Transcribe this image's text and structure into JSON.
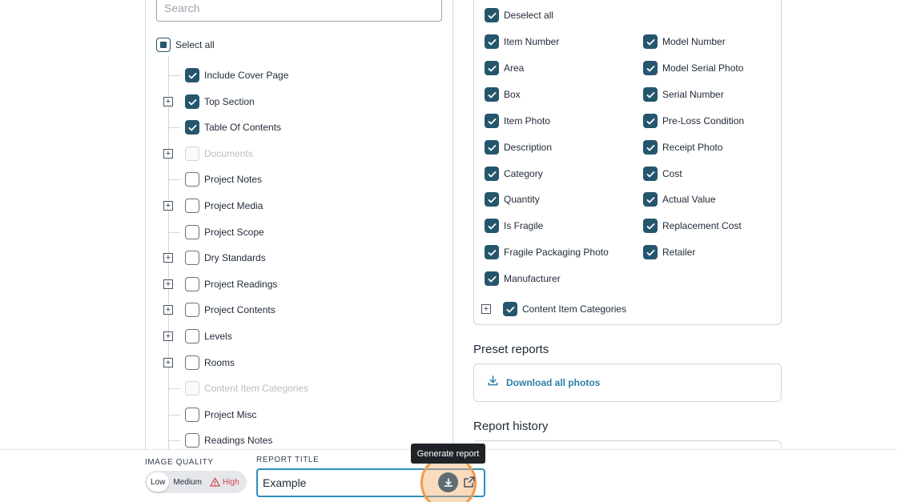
{
  "search": {
    "placeholder": "Search"
  },
  "tree": {
    "select_all_label": "Select all",
    "items": [
      {
        "label": "Include Cover Page",
        "checked": true,
        "disabled": false,
        "expandable": false
      },
      {
        "label": "Top Section",
        "checked": true,
        "disabled": false,
        "expandable": true
      },
      {
        "label": "Table Of Contents",
        "checked": true,
        "disabled": false,
        "expandable": false
      },
      {
        "label": "Documents",
        "checked": false,
        "disabled": true,
        "expandable": true
      },
      {
        "label": "Project Notes",
        "checked": false,
        "disabled": false,
        "expandable": false
      },
      {
        "label": "Project Media",
        "checked": false,
        "disabled": false,
        "expandable": true
      },
      {
        "label": "Project Scope",
        "checked": false,
        "disabled": false,
        "expandable": false
      },
      {
        "label": "Dry Standards",
        "checked": false,
        "disabled": false,
        "expandable": true
      },
      {
        "label": "Project Readings",
        "checked": false,
        "disabled": false,
        "expandable": true
      },
      {
        "label": "Project Contents",
        "checked": false,
        "disabled": false,
        "expandable": true
      },
      {
        "label": "Levels",
        "checked": false,
        "disabled": false,
        "expandable": true
      },
      {
        "label": "Rooms",
        "checked": false,
        "disabled": false,
        "expandable": true
      },
      {
        "label": "Content Item Categories",
        "checked": false,
        "disabled": true,
        "expandable": false
      },
      {
        "label": "Project Misc",
        "checked": false,
        "disabled": false,
        "expandable": false
      },
      {
        "label": "Readings Notes",
        "checked": false,
        "disabled": false,
        "expandable": false
      }
    ]
  },
  "fields": {
    "deselect_all_label": "Deselect all",
    "left_column": [
      "Item Number",
      "Area",
      "Box",
      "Item Photo",
      "Description",
      "Category",
      "Quantity",
      "Is Fragile",
      "Fragile Packaging Photo",
      "Manufacturer"
    ],
    "right_column": [
      "Model Number",
      "Model Serial Photo",
      "Serial Number",
      "Pre-Loss Condition",
      "Receipt Photo",
      "Cost",
      "Actual Value",
      "Replacement Cost",
      "Retailer"
    ],
    "content_item_categories_label": "Content Item Categories"
  },
  "preset_reports": {
    "heading": "Preset reports",
    "download_all_label": "Download all photos"
  },
  "report_history": {
    "heading": "Report history"
  },
  "bottom_bar": {
    "image_quality_caption": "IMAGE QUALITY",
    "quality_options": {
      "low": "Low",
      "medium": "Medium",
      "high": "High"
    },
    "selected_quality": "Low",
    "report_title_caption": "REPORT TITLE",
    "report_title_value": "Example",
    "tooltip": "Generate report"
  },
  "colors": {
    "checkbox_checked": "#25566d",
    "link": "#2b7fa8",
    "input_focus": "#2b8fc0",
    "highlight": "#f09a4a",
    "warning": "#d14343"
  },
  "icons": {
    "check": "check-icon",
    "expand": "plus-square-icon",
    "download": "download-icon",
    "open": "external-link-icon",
    "warning": "warning-triangle-icon"
  }
}
